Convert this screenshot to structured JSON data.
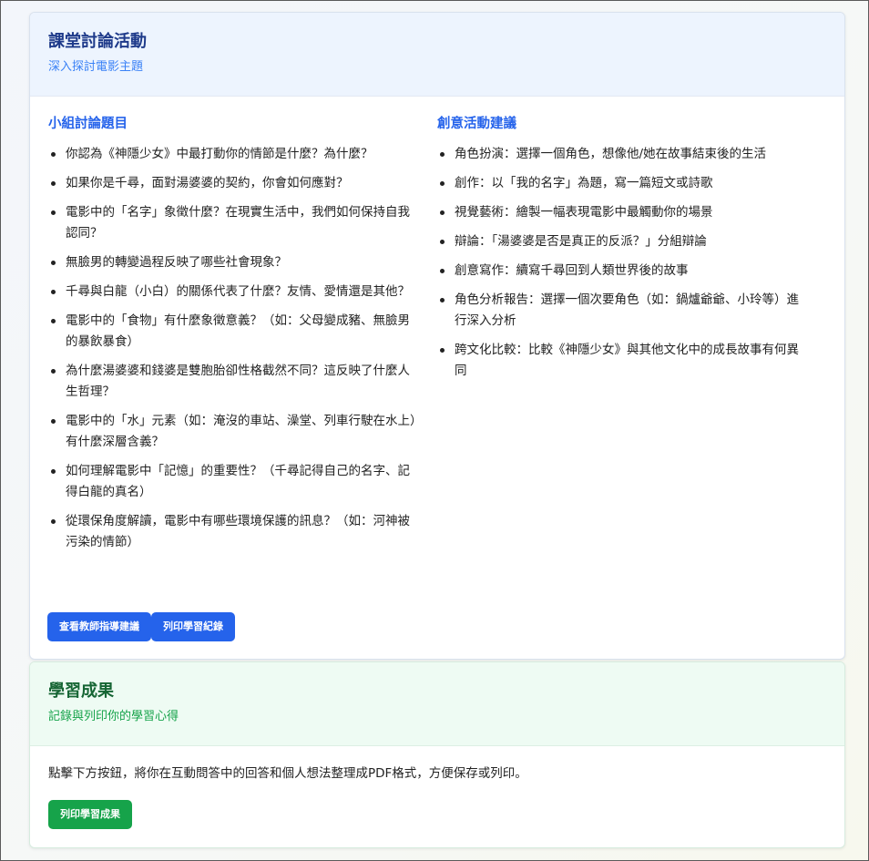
{
  "discussion": {
    "title": "課堂討論活動",
    "subtitle": "深入探討電影主題",
    "questions": {
      "title": "小組討論題目",
      "items": [
        "你認為《神隱少女》中最打動你的情節是什麼？為什麼？",
        "如果你是千尋，面對湯婆婆的契約，你會如何應對？",
        "電影中的「名字」象徵什麼？在現實生活中，我們如何保持自我認同？",
        "無臉男的轉變過程反映了哪些社會現象？",
        "千尋與白龍（小白）的關係代表了什麼？友情、愛情還是其他？",
        "電影中的「食物」有什麼象徵意義？（如：父母變成豬、無臉男的暴飲暴食）",
        "為什麼湯婆婆和錢婆是雙胞胎卻性格截然不同？這反映了什麼人生哲理？",
        "電影中的「水」元素（如：淹沒的車站、澡堂、列車行駛在水上）有什麼深層含義？",
        "如何理解電影中「記憶」的重要性？（千尋記得自己的名字、記得白龍的真名）",
        "從環保角度解讀，電影中有哪些環境保護的訊息？（如：河神被污染的情節）"
      ]
    },
    "activities": {
      "title": "創意活動建議",
      "items": [
        "角色扮演：選擇一個角色，想像他/她在故事結束後的生活",
        "創作：以「我的名字」為題，寫一篇短文或詩歌",
        "視覺藝術：繪製一幅表現電影中最觸動你的場景",
        "辯論：「湯婆婆是否是真正的反派？」分組辯論",
        "創意寫作：續寫千尋回到人類世界後的故事",
        "角色分析報告：選擇一個次要角色（如：鍋爐爺爺、小玲等）進行深入分析",
        "跨文化比較：比較《神隱少女》與其他文化中的成長故事有何異同"
      ]
    },
    "buttons": {
      "teacher_guide": "查看教師指導建議",
      "print_record": "列印學習紀錄"
    }
  },
  "results": {
    "title": "學習成果",
    "subtitle": "記錄與列印你的學習心得",
    "description": "點擊下方按鈕，將你在互動問答中的回答和個人想法整理成PDF格式，方便保存或列印。",
    "print_button": "列印學習成果"
  },
  "colors": {
    "primary_blue": "#2563eb",
    "primary_green": "#16a34a",
    "header_blue_bg": "#edf4fe",
    "header_green_bg": "#eefbf3"
  }
}
